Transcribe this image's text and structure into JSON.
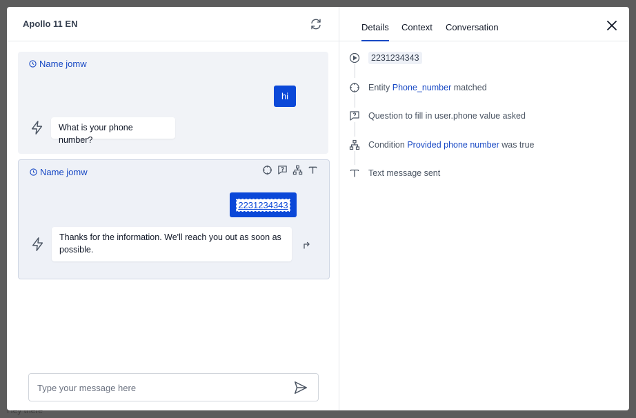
{
  "background": {
    "bottom_text": "Hey there"
  },
  "left_panel": {
    "title": "Apollo 11 EN",
    "refresh_icon": "refresh-icon",
    "cards": [
      {
        "name": "Name jomw",
        "user_message": "hi",
        "bot_message": "What is your phone number?"
      },
      {
        "name": "Name jomw",
        "user_message": "2231234343",
        "bot_message": "Thanks for the information. We'll reach you out as soon as possible.",
        "tools": [
          "crosshair-icon",
          "message-question-icon",
          "hierarchy-icon",
          "text-icon"
        ]
      }
    ],
    "composer": {
      "placeholder": "Type your message here",
      "value": ""
    }
  },
  "right_panel": {
    "tabs": [
      "Details",
      "Context",
      "Conversation"
    ],
    "active_tab": "Details",
    "timeline": [
      {
        "icon": "play-circle-icon",
        "value": "2231234343"
      },
      {
        "icon": "crosshair-icon",
        "prefix": "Entity",
        "highlight": "Phone_number",
        "suffix": "matched"
      },
      {
        "icon": "message-question-icon",
        "text": "Question to fill in user.phone value asked"
      },
      {
        "icon": "hierarchy-icon",
        "prefix": "Condition",
        "highlight": "Provided phone number",
        "suffix": "was true"
      },
      {
        "icon": "text-icon",
        "text": "Text message sent"
      }
    ]
  },
  "colors": {
    "accent": "#1748c4",
    "user_bubble": "#0b48d8",
    "card_bg": "#f1f3f7"
  }
}
